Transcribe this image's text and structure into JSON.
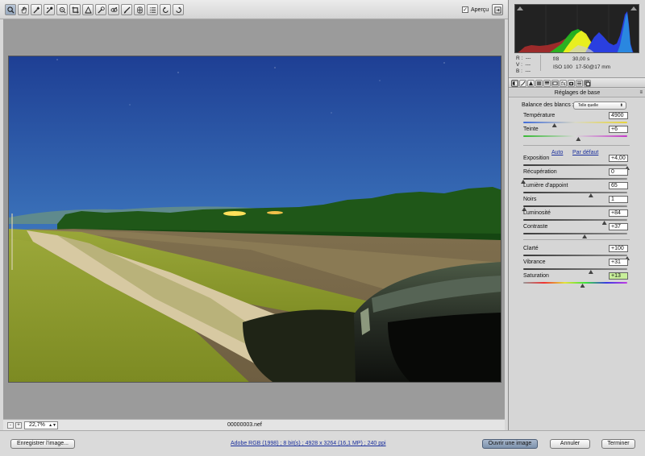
{
  "toolbar": {
    "tools": [
      "zoom-icon",
      "hand-icon",
      "white-balance-icon",
      "color-sampler-icon",
      "target-adjust-icon",
      "crop-icon",
      "straighten-icon",
      "spot-removal-icon",
      "red-eye-icon",
      "adjustment-brush-icon",
      "graduated-filter-icon",
      "list-icon",
      "rotate-left-icon",
      "rotate-right-icon"
    ],
    "preview_label": "Aperçu",
    "preview_checked": "✓"
  },
  "canvas": {
    "filename": "00000003.nef"
  },
  "statusbar": {
    "zoom_minus": "-",
    "zoom_plus": "+",
    "zoom_value": "22,7%",
    "zoom_arrow": "▲▼"
  },
  "info": {
    "rgb": "R :  ---\nV :  ---\nB :  ---",
    "aperture": "f/8",
    "shutter": "30,00 s",
    "iso": "ISO 100",
    "lens": "17-50@17 mm"
  },
  "panel": {
    "title": "Réglages de base",
    "menu_icon": "≡",
    "white_balance_label": "Balance des blancs :",
    "white_balance_value": "Telle quelle",
    "auto_link": "Auto",
    "default_link": "Par défaut",
    "sliders": [
      {
        "id": "temperature",
        "label": "Température",
        "value": "4900",
        "pos": 0.3,
        "track": "temp"
      },
      {
        "id": "tint",
        "label": "Teinte",
        "value": "+6",
        "pos": 0.53,
        "track": "tint"
      },
      {
        "id": "exposure",
        "label": "Exposition",
        "value": "+4,00",
        "pos": 1.0,
        "track": "gray"
      },
      {
        "id": "recovery",
        "label": "Récupération",
        "value": "0",
        "pos": 0.0,
        "track": "gray"
      },
      {
        "id": "fill-light",
        "label": "Lumière d'appoint",
        "value": "65",
        "pos": 0.65,
        "track": "gray"
      },
      {
        "id": "blacks",
        "label": "Noirs",
        "value": "1",
        "pos": 0.01,
        "track": "gray"
      },
      {
        "id": "brightness",
        "label": "Luminosité",
        "value": "+84",
        "pos": 0.78,
        "track": "gray"
      },
      {
        "id": "contrast",
        "label": "Contraste",
        "value": "+37",
        "pos": 0.59,
        "track": "gray"
      },
      {
        "id": "clarity",
        "label": "Clarté",
        "value": "+100",
        "pos": 1.0,
        "track": "gray"
      },
      {
        "id": "vibrance",
        "label": "Vibrance",
        "value": "+31",
        "pos": 0.65,
        "track": "gray"
      },
      {
        "id": "saturation",
        "label": "Saturation",
        "value": "+13",
        "pos": 0.57,
        "track": "sat",
        "highlight": true
      }
    ]
  },
  "footer": {
    "save_label": "Enregistrer l'image...",
    "workflow_link": "Adobe RGB (1998) ; 8 bit(s) ; 4928 x 3264 (16,1 MP) ; 240 ppi",
    "open_label": "Ouvrir une image",
    "cancel_label": "Annuler",
    "done_label": "Terminer"
  },
  "colors": {
    "link": "#1a2f9c",
    "accent": "#7d92ad",
    "highlight_field": "#c8ef9a"
  }
}
